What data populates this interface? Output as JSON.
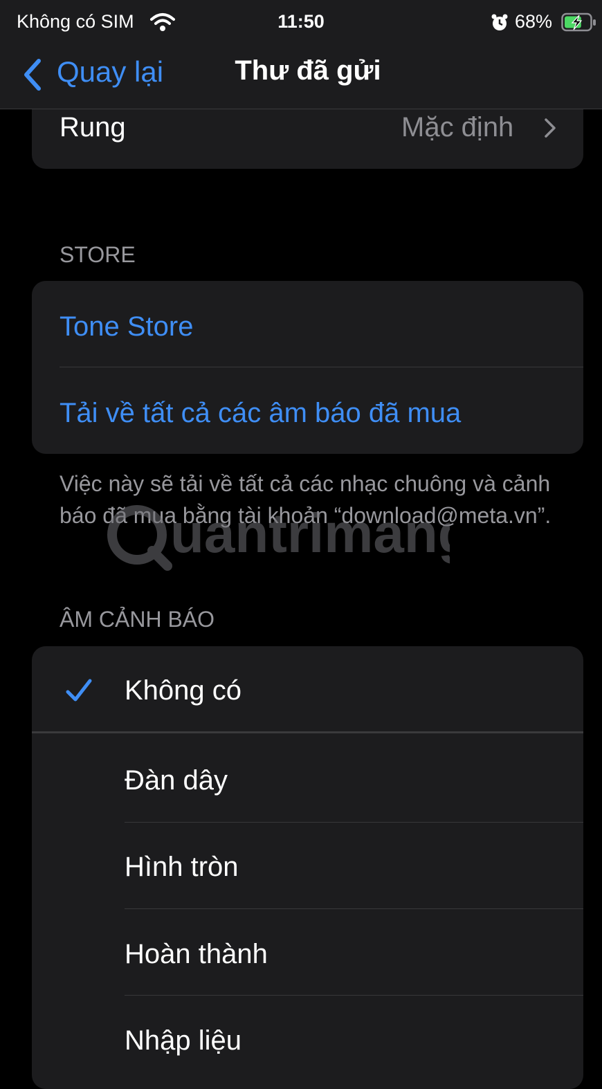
{
  "status_bar": {
    "carrier": "Không có SIM",
    "time": "11:50",
    "battery": "68%",
    "battery_level": 0.68,
    "icons": [
      "wifi-icon",
      "alarm-icon",
      "battery-charging-icon"
    ]
  },
  "nav": {
    "back_label": "Quay lại",
    "title": "Thư đã gửi"
  },
  "vibration_row": {
    "label": "Rung",
    "value": "Mặc định"
  },
  "store": {
    "header": "STORE",
    "tone_store": "Tone Store",
    "download_all": "Tải về tất cả các âm báo đã mua",
    "footer": "Việc này sẽ tải về tất cả các nhạc chuông và cảnh báo đã mua bằng tài khoản “download@meta.vn”."
  },
  "alert_tones": {
    "header": "ÂM CẢNH BÁO",
    "selected_index": 0,
    "items": [
      "Không có",
      "Đàn dây",
      "Hình tròn",
      "Hoàn thành",
      "Nhập liệu"
    ]
  },
  "watermark": "uantrimang",
  "colors": {
    "accent": "#3f8ef5",
    "background": "#000000",
    "group": "#1c1c1e",
    "secondary_text": "#98989d"
  }
}
